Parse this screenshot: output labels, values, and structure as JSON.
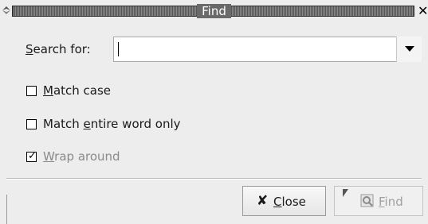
{
  "window": {
    "title": "Find"
  },
  "search": {
    "label_mnemonic": "S",
    "label_rest": "earch for:",
    "value": "",
    "placeholder": ""
  },
  "options": {
    "match_case": {
      "mnemonic": "M",
      "rest": "atch case",
      "checked": false
    },
    "match_word": {
      "prefix": "Match ",
      "mnemonic": "e",
      "rest": "ntire word only",
      "checked": false
    },
    "wrap_around": {
      "mnemonic": "W",
      "rest": "rap around",
      "checked": true,
      "check_glyph": "✓"
    }
  },
  "buttons": {
    "close": {
      "icon": "x-icon",
      "mnemonic": "C",
      "rest": "lose"
    },
    "find": {
      "icon": "find-icon",
      "mnemonic": "F",
      "rest": "ind",
      "enabled": false
    }
  },
  "titlebar": {
    "close_glyph": "✕"
  }
}
